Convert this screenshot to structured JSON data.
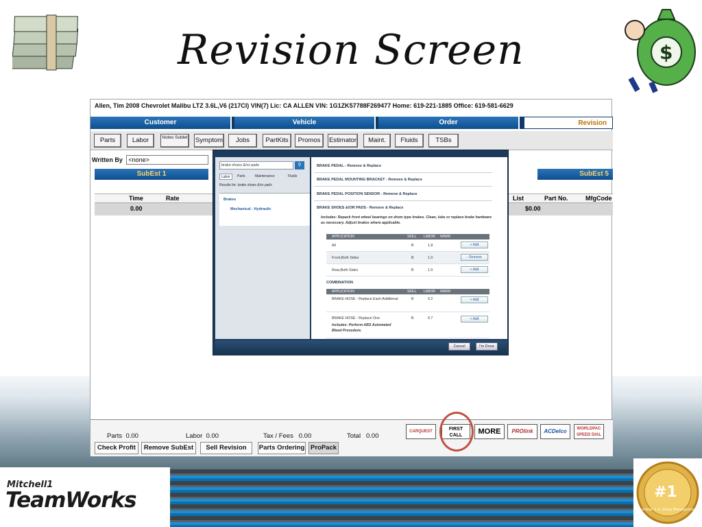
{
  "slide": {
    "title": "Revision Screen",
    "logo_brand": "Mitchell1",
    "logo_product": "TeamWorks",
    "medal_text": "Number 1 in Shop Management",
    "medal_number": "#1"
  },
  "app": {
    "info_bar": "Allen, Tim   2008  Chevrolet Malibu LTZ  3.6L,V6 (217CI) VIN(7) Lic: CA ALLEN  VIN: 1G1ZK57788F269477   Home: 619-221-1885   Office: 619-581-6629",
    "tabs": [
      "Customer",
      "Vehicle",
      "Order",
      "Revision"
    ],
    "toolbar": [
      "Parts",
      "Labor",
      "Notes Sublet",
      "Symptom",
      "Jobs",
      "PartKits",
      "Promos",
      "Estimator",
      "Maint.",
      "Fluids",
      "TSBs"
    ],
    "written_by_label": "Written By",
    "written_by_value": "<none>",
    "subtabs": [
      "SubEst 1",
      "SubEst 5"
    ],
    "grid_headers": [
      "Time",
      "Rate",
      "List",
      "Part No.",
      "MfgCode"
    ],
    "grid_row": {
      "time": "0.00",
      "list": "$0.00"
    },
    "totals": {
      "parts_label": "Parts",
      "parts_value": "0.00",
      "labor_label": "Labor",
      "labor_value": "0.00",
      "tax_label": "Tax / Fees",
      "tax_value": "0.00",
      "total_label": "Total",
      "total_value": "0.00"
    },
    "bottom_buttons": [
      "Check Profit",
      "Remove SubEst",
      "Sell Revision",
      "Parts Ordering",
      "ProPack"
    ],
    "vendor_logos": [
      "CARQUEST",
      "FIRST CALL",
      "MORE",
      "PROlink",
      "ACDelco",
      "WORLDPAC SPEED DIAL"
    ]
  },
  "dialog": {
    "search_value": "brake shoes &/or pads",
    "tabs": [
      "Labor",
      "Parts",
      "Maintenance",
      "Fluids"
    ],
    "results_for_label": "Results for:",
    "results_for_value": "brake shoes &/or pads",
    "categories": [
      "Brakes",
      "Mechanical - Hydraulic"
    ],
    "results": [
      "BRAKE PEDAL - Remove & Replace",
      "BRAKE PEDAL MOUNTING BRACKET - Remove & Replace",
      "BRAKE PEDAL POSITION SENSOR - Remove & Replace",
      "BRAKE SHOES &/OR PADS - Remove & Replace"
    ],
    "includes_text": "Includes: Repack front wheel bearings on drum type brakes. Clean, lube or replace brake hardware as necessary. Adjust brakes where applicable.",
    "table_headers": [
      "APPLICATION",
      "SKILL",
      "LABOR",
      "WARR"
    ],
    "table_rows": [
      {
        "app": "All",
        "skill": "B",
        "labor": "1.8",
        "action": "+ Add"
      },
      {
        "app": "Front,Both Sides",
        "skill": "B",
        "labor": "1.0",
        "action": "- Remove"
      },
      {
        "app": "Rear,Both Sides",
        "skill": "B",
        "labor": "1.0",
        "action": "+ Add"
      }
    ],
    "combination_label": "COMBINATION",
    "combo_rows": [
      {
        "app": "BRAKE HOSE - Replace Each Additional",
        "skill": "B",
        "labor": "0.2",
        "action": "+ Add"
      },
      {
        "app": "BRAKE HOSE - Replace One",
        "skill": "B",
        "labor": "0.7",
        "action": "+ Add",
        "includes": "Includes: Perform ABS Automated Bleed Procedure."
      }
    ],
    "footer_buttons": [
      "Cancel",
      "I'm Done"
    ]
  }
}
